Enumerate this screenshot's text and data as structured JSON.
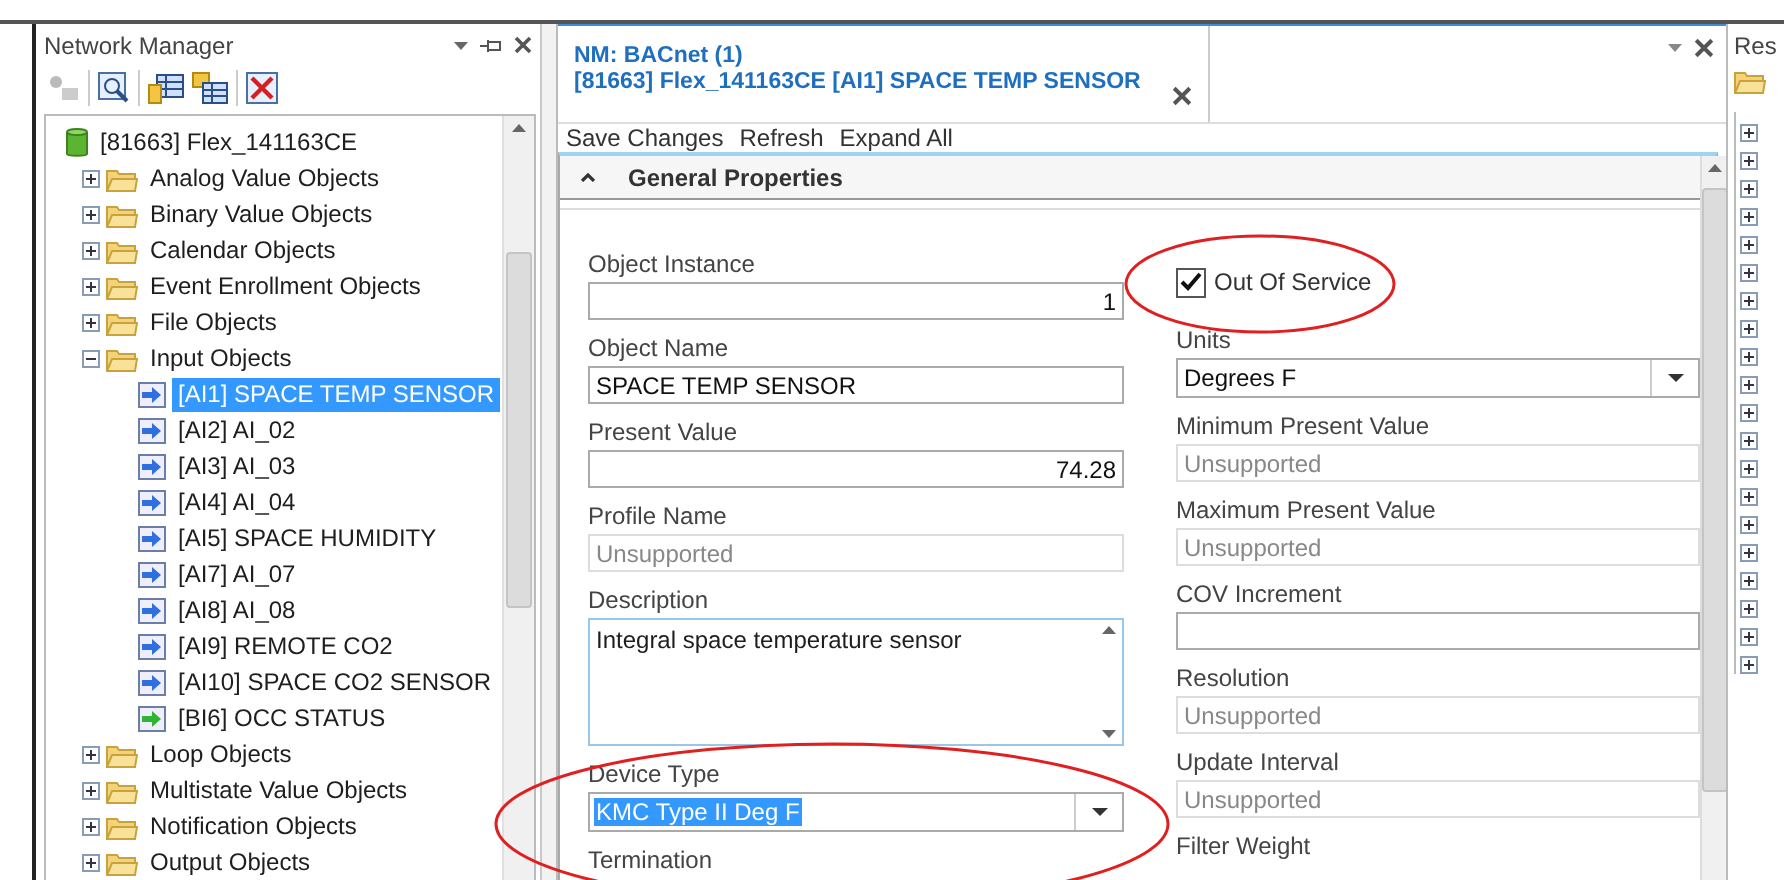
{
  "navigator": {
    "title": "Network Manager",
    "tree": [
      {
        "label": "[81663] Flex_141163CE",
        "kind": "device",
        "selected": false,
        "children": [
          {
            "label": "Analog Value Objects",
            "kind": "folder",
            "expanded": false,
            "selected": false
          },
          {
            "label": "Binary Value Objects",
            "kind": "folder",
            "expanded": false,
            "selected": false
          },
          {
            "label": "Calendar Objects",
            "kind": "folder",
            "expanded": false,
            "selected": false
          },
          {
            "label": "Event Enrollment Objects",
            "kind": "folder",
            "expanded": false,
            "selected": false
          },
          {
            "label": "File Objects",
            "kind": "folder",
            "expanded": false,
            "selected": false
          },
          {
            "label": "Input Objects",
            "kind": "folder",
            "expanded": true,
            "selected": false,
            "children": [
              {
                "label": "[AI1] SPACE TEMP SENSOR",
                "kind": "analog",
                "selected": true
              },
              {
                "label": "[AI2] AI_02",
                "kind": "analog",
                "selected": false
              },
              {
                "label": "[AI3] AI_03",
                "kind": "analog",
                "selected": false
              },
              {
                "label": "[AI4] AI_04",
                "kind": "analog",
                "selected": false
              },
              {
                "label": "[AI5] SPACE HUMIDITY",
                "kind": "analog",
                "selected": false
              },
              {
                "label": "[AI7] AI_07",
                "kind": "analog",
                "selected": false
              },
              {
                "label": "[AI8] AI_08",
                "kind": "analog",
                "selected": false
              },
              {
                "label": "[AI9] REMOTE CO2",
                "kind": "analog",
                "selected": false
              },
              {
                "label": "[AI10] SPACE CO2 SENSOR",
                "kind": "analog",
                "selected": false
              },
              {
                "label": "[BI6] OCC STATUS",
                "kind": "binary",
                "selected": false
              }
            ]
          },
          {
            "label": "Loop Objects",
            "kind": "folder",
            "expanded": false,
            "selected": false
          },
          {
            "label": "Multistate Value Objects",
            "kind": "folder",
            "expanded": false,
            "selected": false
          },
          {
            "label": "Notification Objects",
            "kind": "folder",
            "expanded": false,
            "selected": false
          },
          {
            "label": "Output Objects",
            "kind": "folder",
            "expanded": false,
            "selected": false
          }
        ]
      }
    ]
  },
  "document": {
    "tab": {
      "title": "NM: BACnet (1)",
      "subtitle": "[81663] Flex_141163CE [AI1] SPACE TEMP SENSOR",
      "selected": true
    },
    "toolbar": [
      "Save Changes",
      "Refresh",
      "Expand All"
    ],
    "section": {
      "title": "General Properties",
      "expanded": true
    },
    "left_fields": [
      {
        "label": "Object Instance",
        "kind": "number",
        "value": "1"
      },
      {
        "label": "Object Name",
        "kind": "text",
        "value": "SPACE TEMP SENSOR"
      },
      {
        "label": "Present Value",
        "kind": "number",
        "value": "74.28"
      },
      {
        "label": "Profile Name",
        "kind": "readonly",
        "value": "Unsupported"
      },
      {
        "label": "Description",
        "kind": "memo",
        "value": "Integral space temperature sensor"
      },
      {
        "label": "Device Type",
        "kind": "combo",
        "value": "KMC Type II Deg F",
        "selected": true
      },
      {
        "label": "Termination",
        "kind": "label"
      }
    ],
    "right_fields": [
      {
        "label": "Out Of Service",
        "kind": "checkbox",
        "checked": true
      },
      {
        "label": "Units",
        "kind": "combo",
        "value": "Degrees F",
        "selected": false
      },
      {
        "label": "Minimum Present Value",
        "kind": "readonly",
        "value": "Unsupported"
      },
      {
        "label": "Maximum Present Value",
        "kind": "readonly",
        "value": "Unsupported"
      },
      {
        "label": "COV Increment",
        "kind": "text"
      },
      {
        "label": "Resolution",
        "kind": "readonly",
        "value": "Unsupported"
      },
      {
        "label": "Update Interval",
        "kind": "readonly",
        "value": "Unsupported"
      },
      {
        "label": "Filter Weight",
        "kind": "label"
      }
    ]
  },
  "right_panel": {
    "title": "Res"
  }
}
